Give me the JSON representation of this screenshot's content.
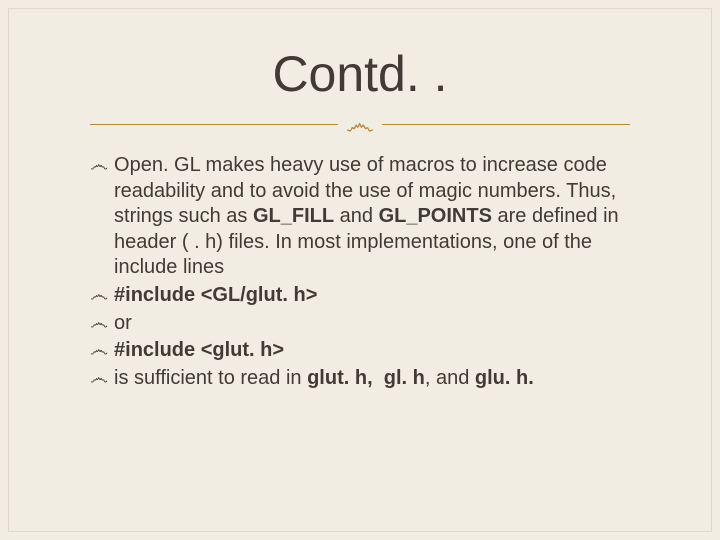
{
  "title": "Contd. .",
  "divider_glyph": "෴",
  "bullet_glyph": "෴",
  "items": [
    {
      "html": "Open. GL makes heavy use of macros to increase code readability and to avoid the use of magic numbers. Thus, strings such as <b>GL_FILL</b> and <b>GL_POINTS</b> are defined in header ( . h) files. In most implementations, one of the include lines"
    },
    {
      "html": "<b>#include &lt;GL/glut. h&gt;</b>"
    },
    {
      "html": "or"
    },
    {
      "html": "<b>#include &lt;glut. h&gt;</b>"
    },
    {
      "html": "is sufficient to read in <b>glut. h,&nbsp; gl. h</b>, and <b>glu. h.</b>"
    }
  ]
}
